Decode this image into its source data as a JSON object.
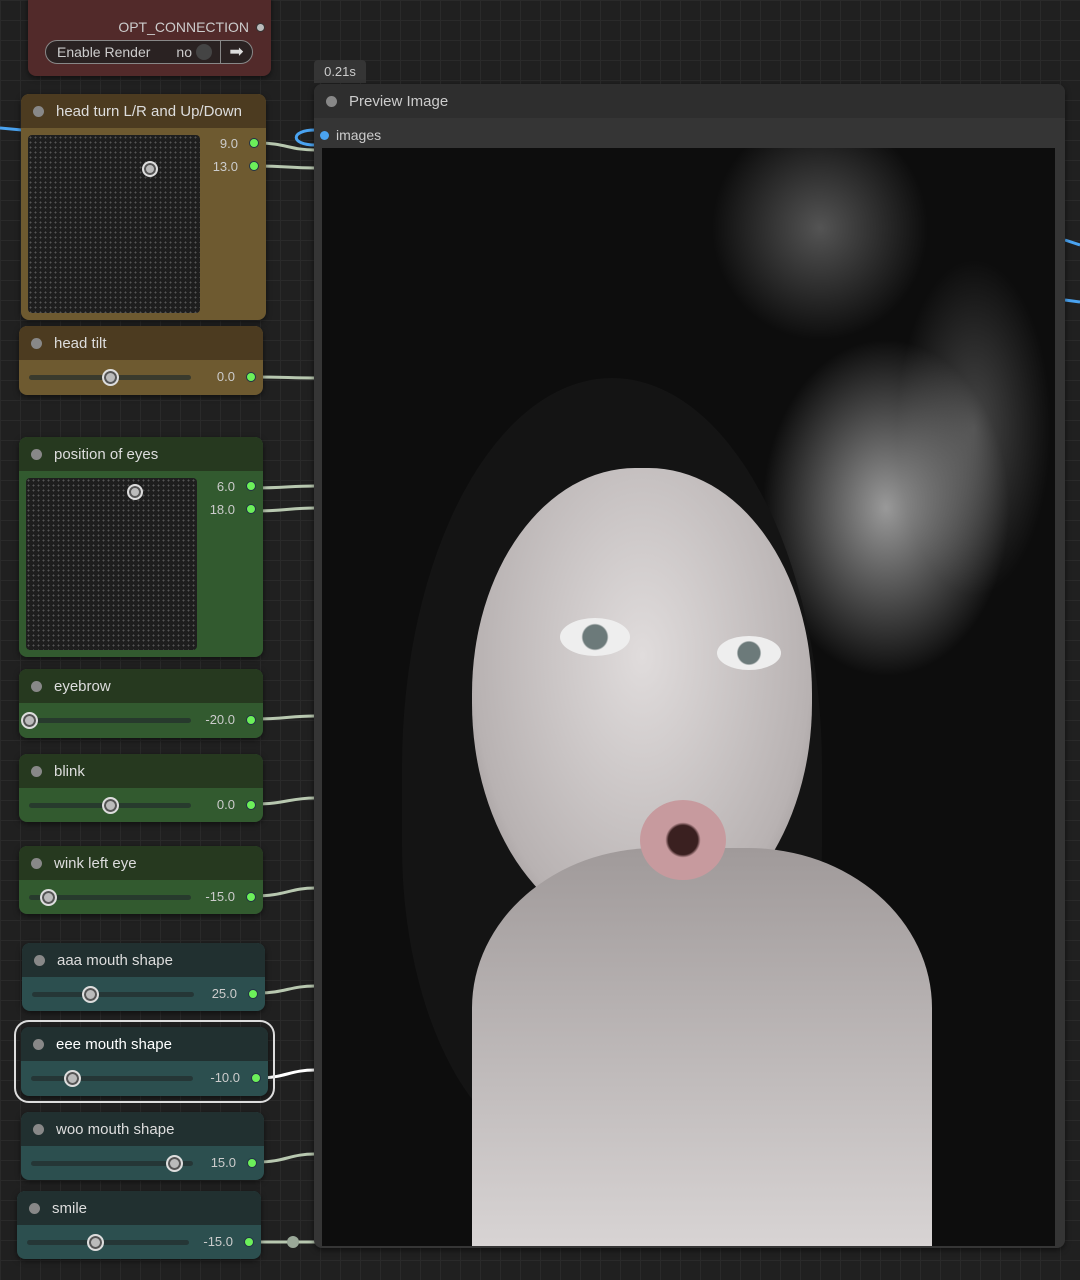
{
  "opt_node": {
    "output_label": "OPT_CONNECTION",
    "toggle_label": "Enable Render",
    "toggle_value": "no"
  },
  "preview": {
    "timing_badge": "0.21s",
    "title": "Preview Image",
    "input_label": "images"
  },
  "nodes": [
    {
      "id": "head-turn",
      "title": "head turn L/R and Up/Down",
      "type": "pad",
      "values": [
        "9.0",
        "13.0"
      ],
      "theme": "brown"
    },
    {
      "id": "head-tilt",
      "title": "head tilt",
      "type": "slider",
      "value": "0.0",
      "fraction": 0.5,
      "theme": "brown"
    },
    {
      "id": "position-of-eyes",
      "title": "position of eyes",
      "type": "pad",
      "values": [
        "6.0",
        "18.0"
      ],
      "theme": "green"
    },
    {
      "id": "eyebrow",
      "title": "eyebrow",
      "type": "slider",
      "value": "-20.0",
      "fraction": 0.0,
      "theme": "green"
    },
    {
      "id": "blink",
      "title": "blink",
      "type": "slider",
      "value": "0.0",
      "fraction": 0.5,
      "theme": "green"
    },
    {
      "id": "wink-left-eye",
      "title": "wink left eye",
      "type": "slider",
      "value": "-15.0",
      "fraction": 0.12,
      "theme": "green"
    },
    {
      "id": "aaa-mouth-shape",
      "title": "aaa mouth shape",
      "type": "slider",
      "value": "25.0",
      "fraction": 0.36,
      "theme": "teal"
    },
    {
      "id": "eee-mouth-shape",
      "title": "eee mouth shape",
      "type": "slider",
      "value": "-10.0",
      "fraction": 0.25,
      "theme": "teal",
      "selected": true
    },
    {
      "id": "woo-mouth-shape",
      "title": "woo mouth shape",
      "type": "slider",
      "value": "15.0",
      "fraction": 0.88,
      "theme": "teal"
    },
    {
      "id": "smile",
      "title": "smile",
      "type": "slider",
      "value": "-15.0",
      "fraction": 0.42,
      "theme": "teal"
    }
  ],
  "themes": {
    "brown": [
      "#4c3b20",
      "#6e5a30"
    ],
    "green": [
      "#26391f",
      "#325a2f"
    ],
    "teal": [
      "#213030",
      "#2c4f4f"
    ]
  }
}
